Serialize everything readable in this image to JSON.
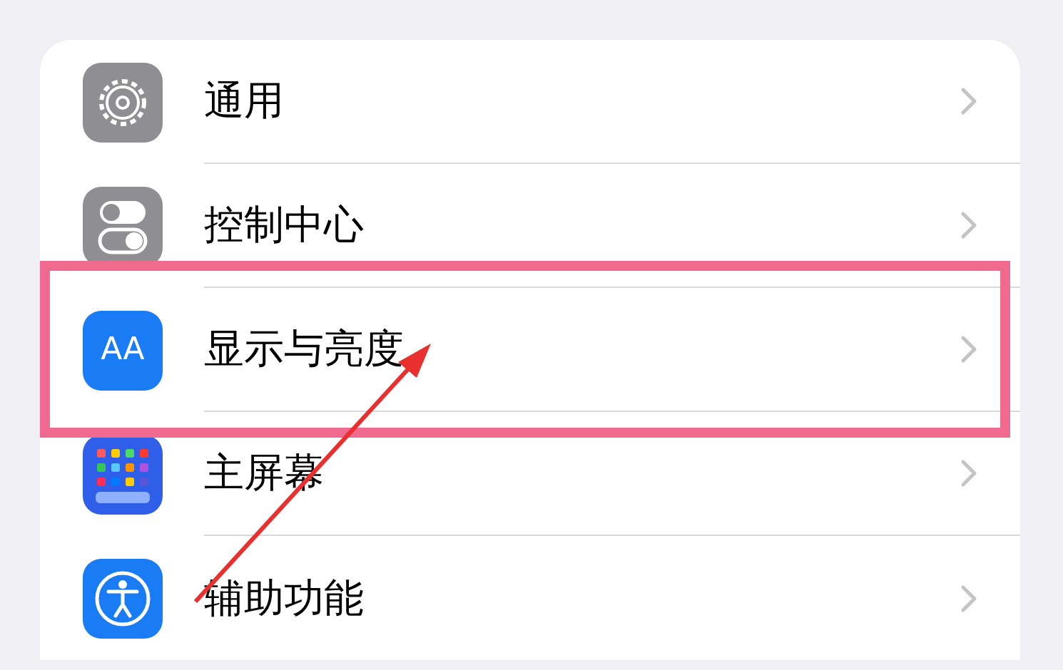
{
  "settings_rows": [
    {
      "label": "通用",
      "kind": "gear",
      "highlighted": false
    },
    {
      "label": "控制中心",
      "kind": "toggles",
      "highlighted": false
    },
    {
      "label": "显示与亮度",
      "kind": "text",
      "icon_text": "AA",
      "highlighted": true
    },
    {
      "label": "主屏幕",
      "kind": "grid",
      "highlighted": false
    },
    {
      "label": "辅助功能",
      "kind": "accessibility",
      "highlighted": false
    }
  ]
}
